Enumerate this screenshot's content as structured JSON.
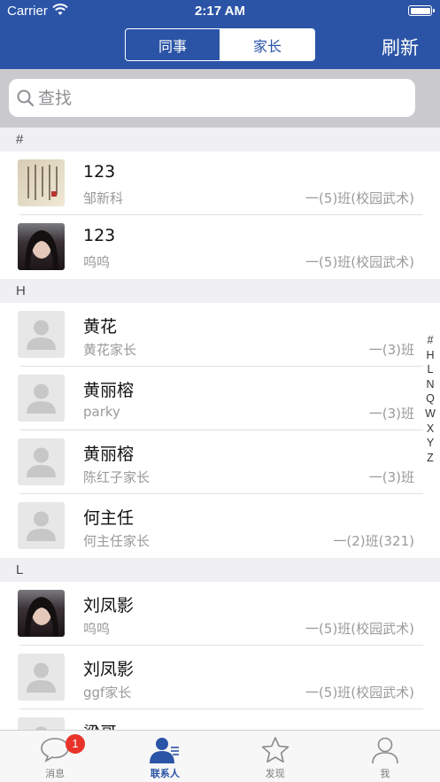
{
  "status_bar": {
    "carrier": "Carrier",
    "time": "2:17 AM"
  },
  "header": {
    "segments": [
      {
        "label": "同事",
        "selected": false
      },
      {
        "label": "家长",
        "selected": true
      }
    ],
    "refresh_label": "刷新",
    "accent_color": "#2b54a7"
  },
  "search": {
    "placeholder": "查找",
    "value": ""
  },
  "sections": [
    {
      "letter": "#",
      "contacts": [
        {
          "name": "123",
          "subtitle": "邹新科",
          "class_name": "一(5)班(校园武术)",
          "avatar": "calligraphy"
        },
        {
          "name": "123",
          "subtitle": "呜呜",
          "class_name": "一(5)班(校园武术)",
          "avatar": "photo"
        }
      ]
    },
    {
      "letter": "H",
      "contacts": [
        {
          "name": "黄花",
          "subtitle": "黄花家长",
          "class_name": "一(3)班",
          "avatar": "default"
        },
        {
          "name": "黄丽榕",
          "subtitle": "parky",
          "class_name": "一(3)班",
          "avatar": "default"
        },
        {
          "name": "黄丽榕",
          "subtitle": "陈红子家长",
          "class_name": "一(3)班",
          "avatar": "default"
        },
        {
          "name": "何主任",
          "subtitle": "何主任家长",
          "class_name": "一(2)班(321)",
          "avatar": "default"
        }
      ]
    },
    {
      "letter": "L",
      "contacts": [
        {
          "name": "刘凤影",
          "subtitle": "呜呜",
          "class_name": "一(5)班(校园武术)",
          "avatar": "photo"
        },
        {
          "name": "刘凤影",
          "subtitle": "ggf家长",
          "class_name": "一(5)班(校园武术)",
          "avatar": "default"
        },
        {
          "name": "梁哥",
          "subtitle": "",
          "class_name": "",
          "avatar": "default"
        }
      ]
    }
  ],
  "index_letters": [
    "#",
    "H",
    "L",
    "N",
    "Q",
    "W",
    "X",
    "Y",
    "Z"
  ],
  "tabbar": {
    "tabs": [
      {
        "label": "消息",
        "icon": "message-icon",
        "badge": "1",
        "active": false
      },
      {
        "label": "联系人",
        "icon": "contacts-icon",
        "active": true
      },
      {
        "label": "发现",
        "icon": "star-icon",
        "active": false
      },
      {
        "label": "我",
        "icon": "person-icon",
        "active": false
      }
    ]
  }
}
